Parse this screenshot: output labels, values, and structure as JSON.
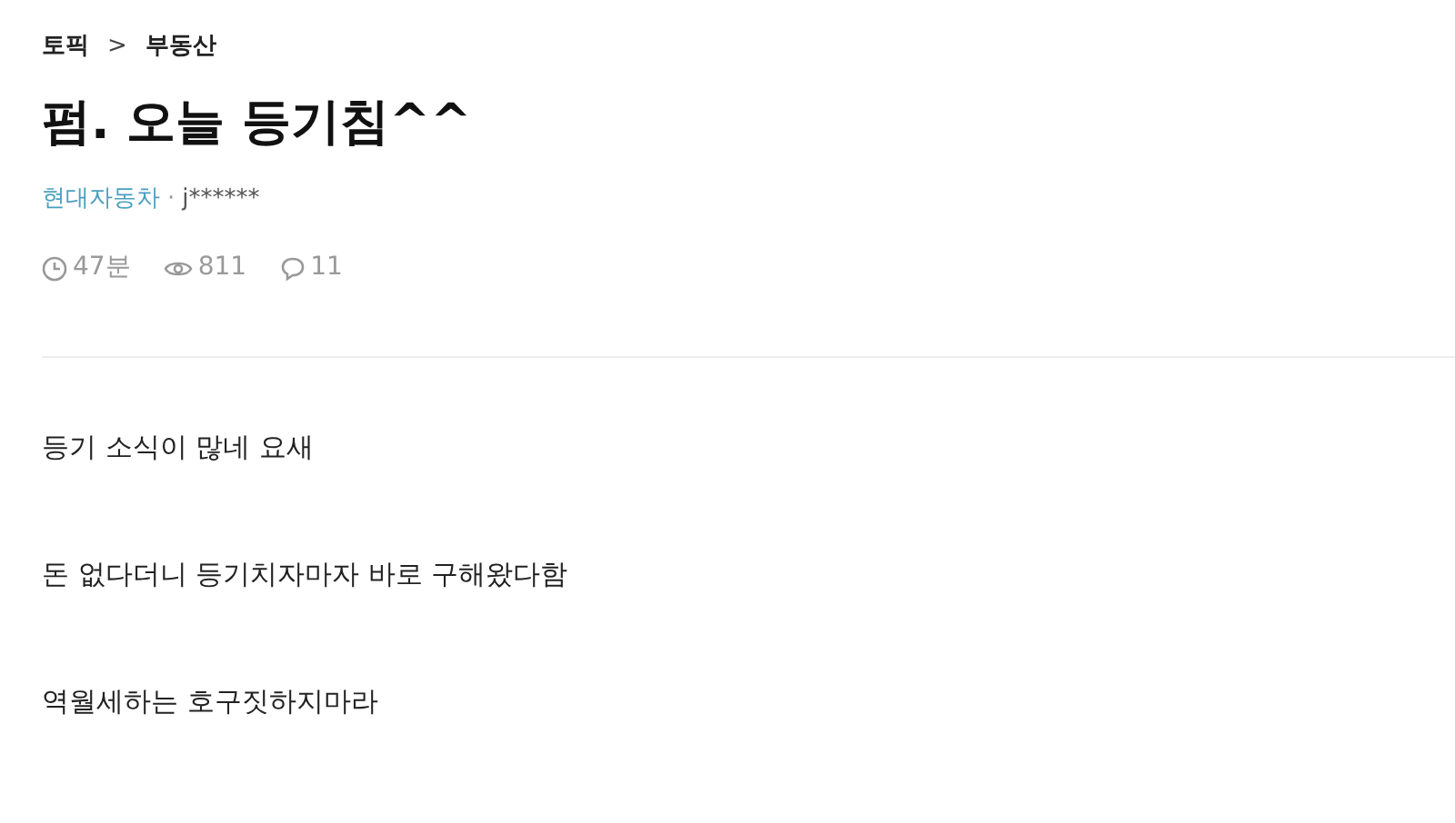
{
  "breadcrumb": {
    "topic": "토픽",
    "separator": ">",
    "category": "부동산"
  },
  "title": "펌. 오늘 등기침^^",
  "meta": {
    "company": "현대자동차",
    "separator": "·",
    "author": "j******"
  },
  "stats": {
    "time": "47분",
    "views": "811",
    "comments": "11"
  },
  "paragraphs": [
    "등기 소식이 많네 요새",
    "돈 없다더니 등기치자마자 바로 구해왔다함",
    "역월세하는 호구짓하지마라"
  ]
}
